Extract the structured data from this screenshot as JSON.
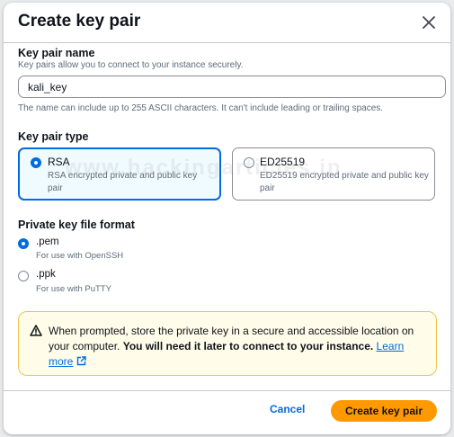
{
  "dialog": {
    "title": "Create key pair",
    "close_icon": "close-icon"
  },
  "key_name": {
    "label": "Key pair name",
    "description": "Key pairs allow you to connect to your instance securely.",
    "value": "kali_key",
    "hint": "The name can include up to 255 ASCII characters. It can't include leading or trailing spaces."
  },
  "key_type": {
    "label": "Key pair type",
    "options": [
      {
        "title": "RSA",
        "description": "RSA encrypted private and public key pair",
        "selected": true
      },
      {
        "title": "ED25519",
        "description": "ED25519 encrypted private and public key pair",
        "selected": false
      }
    ]
  },
  "file_format": {
    "label": "Private key file format",
    "options": [
      {
        "title": ".pem",
        "description": "For use with OpenSSH",
        "selected": true
      },
      {
        "title": ".ppk",
        "description": "For use with PuTTY",
        "selected": false
      }
    ]
  },
  "alert": {
    "icon": "warning-icon",
    "text": "When prompted, store the private key in a secure and accessible location on your computer. ",
    "strong": "You will need it later to connect to your instance.",
    "link": "Learn more",
    "link_icon": "external-link-icon"
  },
  "footer": {
    "cancel_label": "Cancel",
    "create_label": "Create key pair"
  },
  "watermark": "www.hackingarticles.in",
  "colors": {
    "accent": "#006ce0",
    "primary_button": "#ff9900",
    "warning_border": "#f0c447",
    "warning_bg": "#fffce9"
  }
}
